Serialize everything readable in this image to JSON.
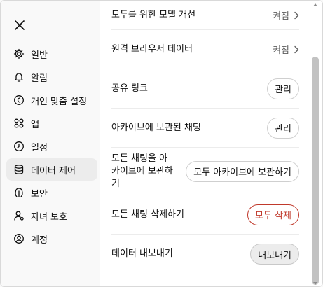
{
  "sidebar": {
    "items": [
      {
        "label": "일반",
        "icon": "gear-icon"
      },
      {
        "label": "알림",
        "icon": "bell-icon"
      },
      {
        "label": "개인 맞춤 설정",
        "icon": "personalize-icon"
      },
      {
        "label": "앱",
        "icon": "apps-grid-icon"
      },
      {
        "label": "일정",
        "icon": "clock-icon"
      },
      {
        "label": "데이터 제어",
        "icon": "database-icon",
        "active": true
      },
      {
        "label": "보안",
        "icon": "shield-icon"
      },
      {
        "label": "자녀 보호",
        "icon": "parental-user-icon"
      },
      {
        "label": "계정",
        "icon": "account-icon"
      }
    ]
  },
  "settings": {
    "model_improvement": {
      "label": "모두를 위한 모델 개선",
      "value": "켜짐"
    },
    "remote_browser": {
      "label": "원격 브라우저 데이터",
      "value": "켜짐"
    },
    "shared_links": {
      "label": "공유 링크",
      "button": "관리"
    },
    "archived_chats": {
      "label": "아카이브에 보관된 채팅",
      "button": "관리"
    },
    "archive_all": {
      "label_lines": [
        "모든 채팅을 아",
        "카이브에 보관하",
        "기"
      ],
      "button": "모두 아카이브에 보관하기"
    },
    "delete_all": {
      "label": "모든 채팅 삭제하기",
      "button": "모두 삭제"
    },
    "export": {
      "label": "데이터 내보내기",
      "button": "내보내기"
    }
  },
  "colors": {
    "danger": "#c0392b",
    "active_bg": "#ececec",
    "panel_bg": "#ffffff",
    "sidebar_bg": "#f9f9f9"
  }
}
